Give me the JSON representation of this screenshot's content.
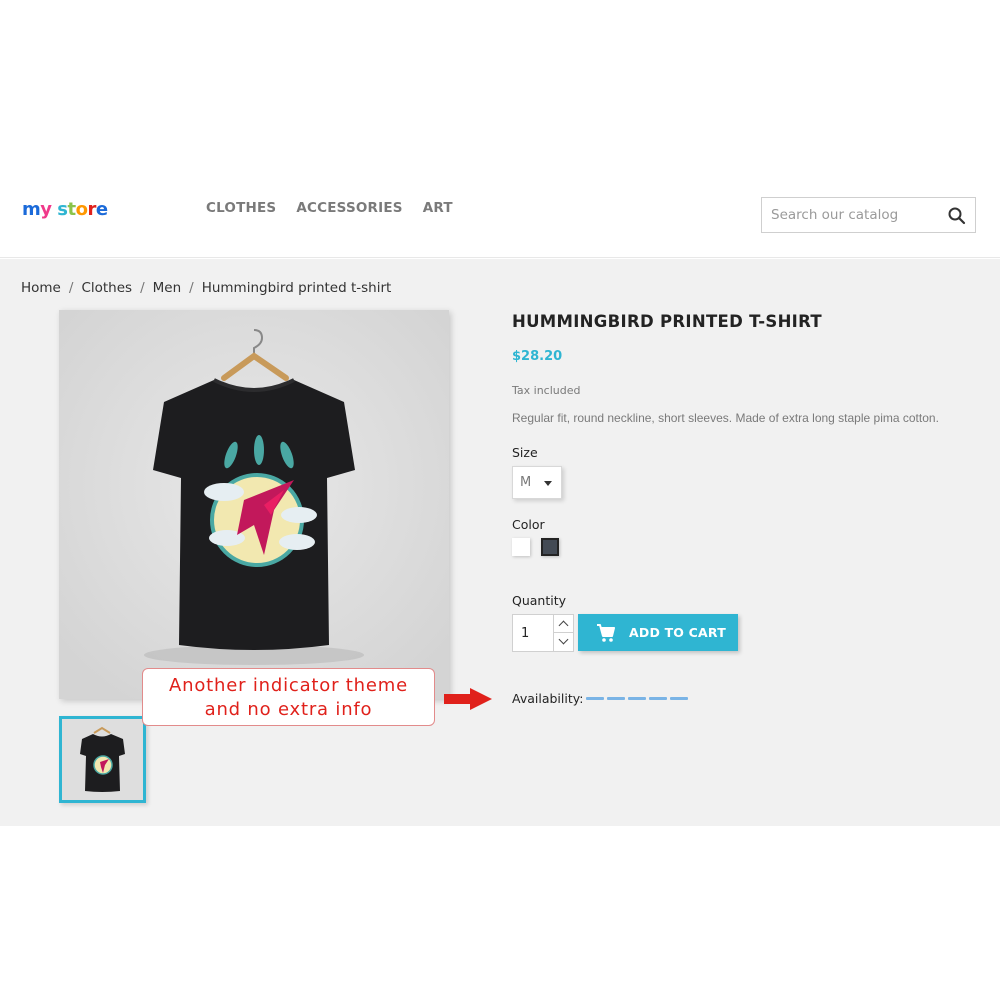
{
  "header": {
    "logo_text": "my store",
    "nav": [
      "CLOTHES",
      "ACCESSORIES",
      "ART"
    ],
    "search": {
      "placeholder": "Search our catalog",
      "icon": "search-icon"
    }
  },
  "breadcrumb": [
    "Home",
    "Clothes",
    "Men",
    "Hummingbird printed t-shirt"
  ],
  "product": {
    "title": "HUMMINGBIRD PRINTED T-SHIRT",
    "price": "$28.20",
    "tax_note": "Tax included",
    "description": "Regular fit, round neckline, short sleeves. Made of extra long staple pima cotton.",
    "size_label": "Size",
    "size_value": "M",
    "color_label": "Color",
    "colors": [
      "#ffffff",
      "#434a54"
    ],
    "quantity_label": "Quantity",
    "quantity_value": "1",
    "add_to_cart": "ADD TO CART",
    "availability_label": "Availability:"
  },
  "annotation": {
    "line1": "Another indicator theme",
    "line2": "and no extra info"
  },
  "colors": {
    "accent": "#2fb5d2",
    "availability": "#7ab4e6",
    "annotation_red": "#e0211b"
  }
}
